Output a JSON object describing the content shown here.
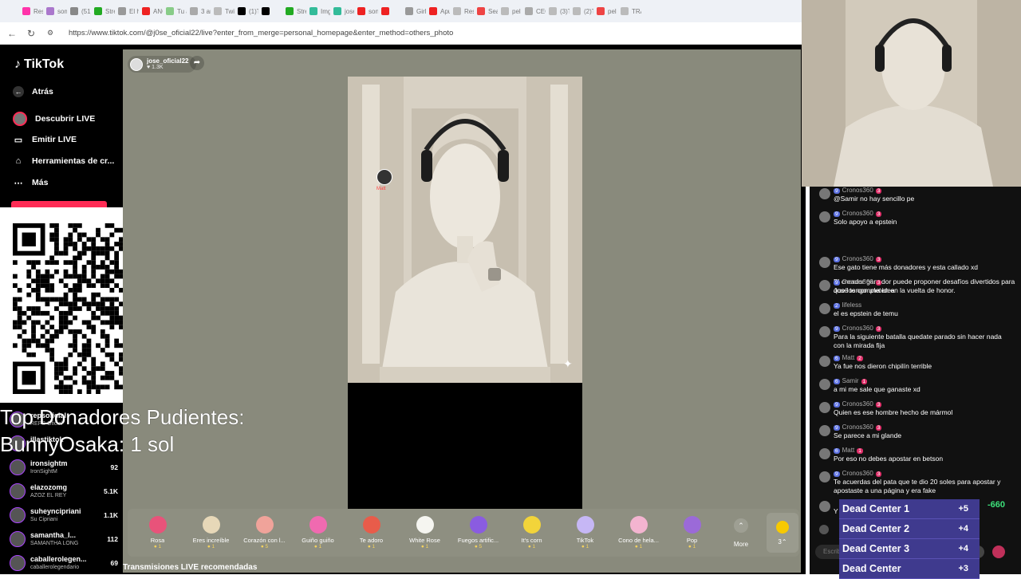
{
  "browser": {
    "url": "https://www.tiktok.com/@j0se_oficial22/live?enter_from_merge=personal_homepage&enter_method=others_photo",
    "tabs": [
      "Resi",
      "som",
      "(51)",
      "Stre",
      "El ho",
      "ANG",
      "Tu a",
      "3 an",
      "Twit",
      "(1)T",
      "",
      "Stre",
      "Img",
      "jose",
      "son",
      "",
      "Girl",
      "Apu",
      "Res",
      "Sea",
      "pel",
      "CEC",
      "(3)T",
      "(2)T",
      "pel",
      "TRA"
    ]
  },
  "sidebar": {
    "logo": "TikTok",
    "items": [
      {
        "label": "Atrás",
        "icon": "back-arrow-icon"
      },
      {
        "label": "Descubrir LIVE",
        "icon": "live-avatar-icon"
      },
      {
        "label": "Emitir LIVE",
        "icon": "camera-icon"
      },
      {
        "label": "Herramientas de cr...",
        "icon": "home-tools-icon"
      },
      {
        "label": "Más",
        "icon": "more-dots-icon"
      }
    ]
  },
  "stream": {
    "host_name": "jose_oficial22",
    "host_likes": "1.3K",
    "sticker_label": "Matt"
  },
  "gifts": [
    {
      "name": "Rosa",
      "price": "1",
      "icon": "rose-icon",
      "color": "#e8537a"
    },
    {
      "name": "Eres increíble",
      "price": "1",
      "icon": "cat-icon",
      "color": "#e7d8b8"
    },
    {
      "name": "Corazón con l...",
      "price": "5",
      "icon": "heart-hand-icon",
      "color": "#f0a39a"
    },
    {
      "name": "Guiño guiño",
      "price": "1",
      "icon": "heart-icon",
      "color": "#f06ab0"
    },
    {
      "name": "Te adoro",
      "price": "1",
      "icon": "love-icon",
      "color": "#e85c4a"
    },
    {
      "name": "White Rose",
      "price": "1",
      "icon": "white-rose-icon",
      "color": "#f5f5f0"
    },
    {
      "name": "Fuegos artific...",
      "price": "5",
      "icon": "fireworks-icon",
      "color": "#8a5ce0"
    },
    {
      "name": "It's corn",
      "price": "1",
      "icon": "corn-icon",
      "color": "#f2d43a"
    },
    {
      "name": "TikTok",
      "price": "1",
      "icon": "tiktok-gift-icon",
      "color": "#c6b7f5"
    },
    {
      "name": "Cono de hela...",
      "price": "1",
      "icon": "ice-cream-icon",
      "color": "#f3b4d0"
    },
    {
      "name": "Pop",
      "price": "1",
      "icon": "pop-icon",
      "color": "#9b6ad8"
    }
  ],
  "gift_more": "More",
  "coins": "3",
  "recommended_title": "Transmisiones LIVE recomendadas",
  "overlay": {
    "line1": "Top Donadores Pudientes:",
    "line2": "BunnyOsaka: 1 sol"
  },
  "leaderboard": [
    {
      "name": "repsoficial",
      "sub": "REPS Oficial",
      "value": ""
    },
    {
      "name": "illastiktok",
      "sub": "",
      "value": ""
    },
    {
      "name": "ironsightm",
      "sub": "IronSightM",
      "value": "92"
    },
    {
      "name": "elazozomg",
      "sub": "AZOZ EL REY",
      "value": "5.1K"
    },
    {
      "name": "suheyncipriani",
      "sub": "Su Cipriani",
      "value": "1.1K"
    },
    {
      "name": "samantha_l...",
      "sub": "SAMANTHA LONG",
      "value": "112"
    },
    {
      "name": "caballerolegen...",
      "sub": "caballerolegendario",
      "value": "69"
    }
  ],
  "chat": {
    "messages": [
      {
        "user": "Cronos360",
        "lvl": "9",
        "rank": "3",
        "text": "@Samir no hay sencillo pe"
      },
      {
        "user": "Cronos360",
        "lvl": "9",
        "rank": "3",
        "text": "Solo apoyo a epstein"
      },
      {
        "system": true,
        "text": "El creador ganador puede proponer desafíos divertidos para que los completen en la vuelta de honor."
      },
      {
        "user": "Cronos360",
        "lvl": "9",
        "rank": "3",
        "text": "Ese gato tiene más donadores y esta callado xd"
      },
      {
        "user": "Cronos360",
        "lvl": "9",
        "rank": "3",
        "text": "José tengo una idea"
      },
      {
        "user": "lifeless",
        "lvl": "2",
        "rank": "",
        "text": "el es epstein de temu"
      },
      {
        "user": "Cronos360",
        "lvl": "9",
        "rank": "3",
        "text": "Para la siguiente batalla quedate parado sin hacer nada con la mirada fija"
      },
      {
        "user": "Matt",
        "lvl": "6",
        "rank": "2",
        "text": "Ya fue nos dieron chipilín terrible"
      },
      {
        "user": "Samir",
        "lvl": "6",
        "rank": "1",
        "text": "a mi me sale que ganaste xd"
      },
      {
        "user": "Cronos360",
        "lvl": "9",
        "rank": "3",
        "text": "Quien es ese hombre hecho de mármol"
      },
      {
        "user": "Cronos360",
        "lvl": "9",
        "rank": "3",
        "text": "Se parece a mi glande"
      },
      {
        "user": "Matt",
        "lvl": "6",
        "rank": "1",
        "text": "Por eso no debes apostar en betson"
      },
      {
        "user": "Cronos360",
        "lvl": "9",
        "rank": "3",
        "text": "Te acuerdas del pata que te dio 20 soles para apostar y apostaste a una página y era fake"
      },
      {
        "user": "",
        "lvl": "",
        "rank": "",
        "text": "Y te robaron tus 20 so"
      }
    ],
    "input_placeholder": "Escribe..."
  },
  "dead_center": [
    {
      "name": "Dead Center 1",
      "score": "+5"
    },
    {
      "name": "Dead Center 2",
      "score": "+4"
    },
    {
      "name": "Dead Center 3",
      "score": "+4"
    },
    {
      "name": "Dead Center",
      "score": "+3"
    }
  ],
  "dead_center_delta": "-660"
}
